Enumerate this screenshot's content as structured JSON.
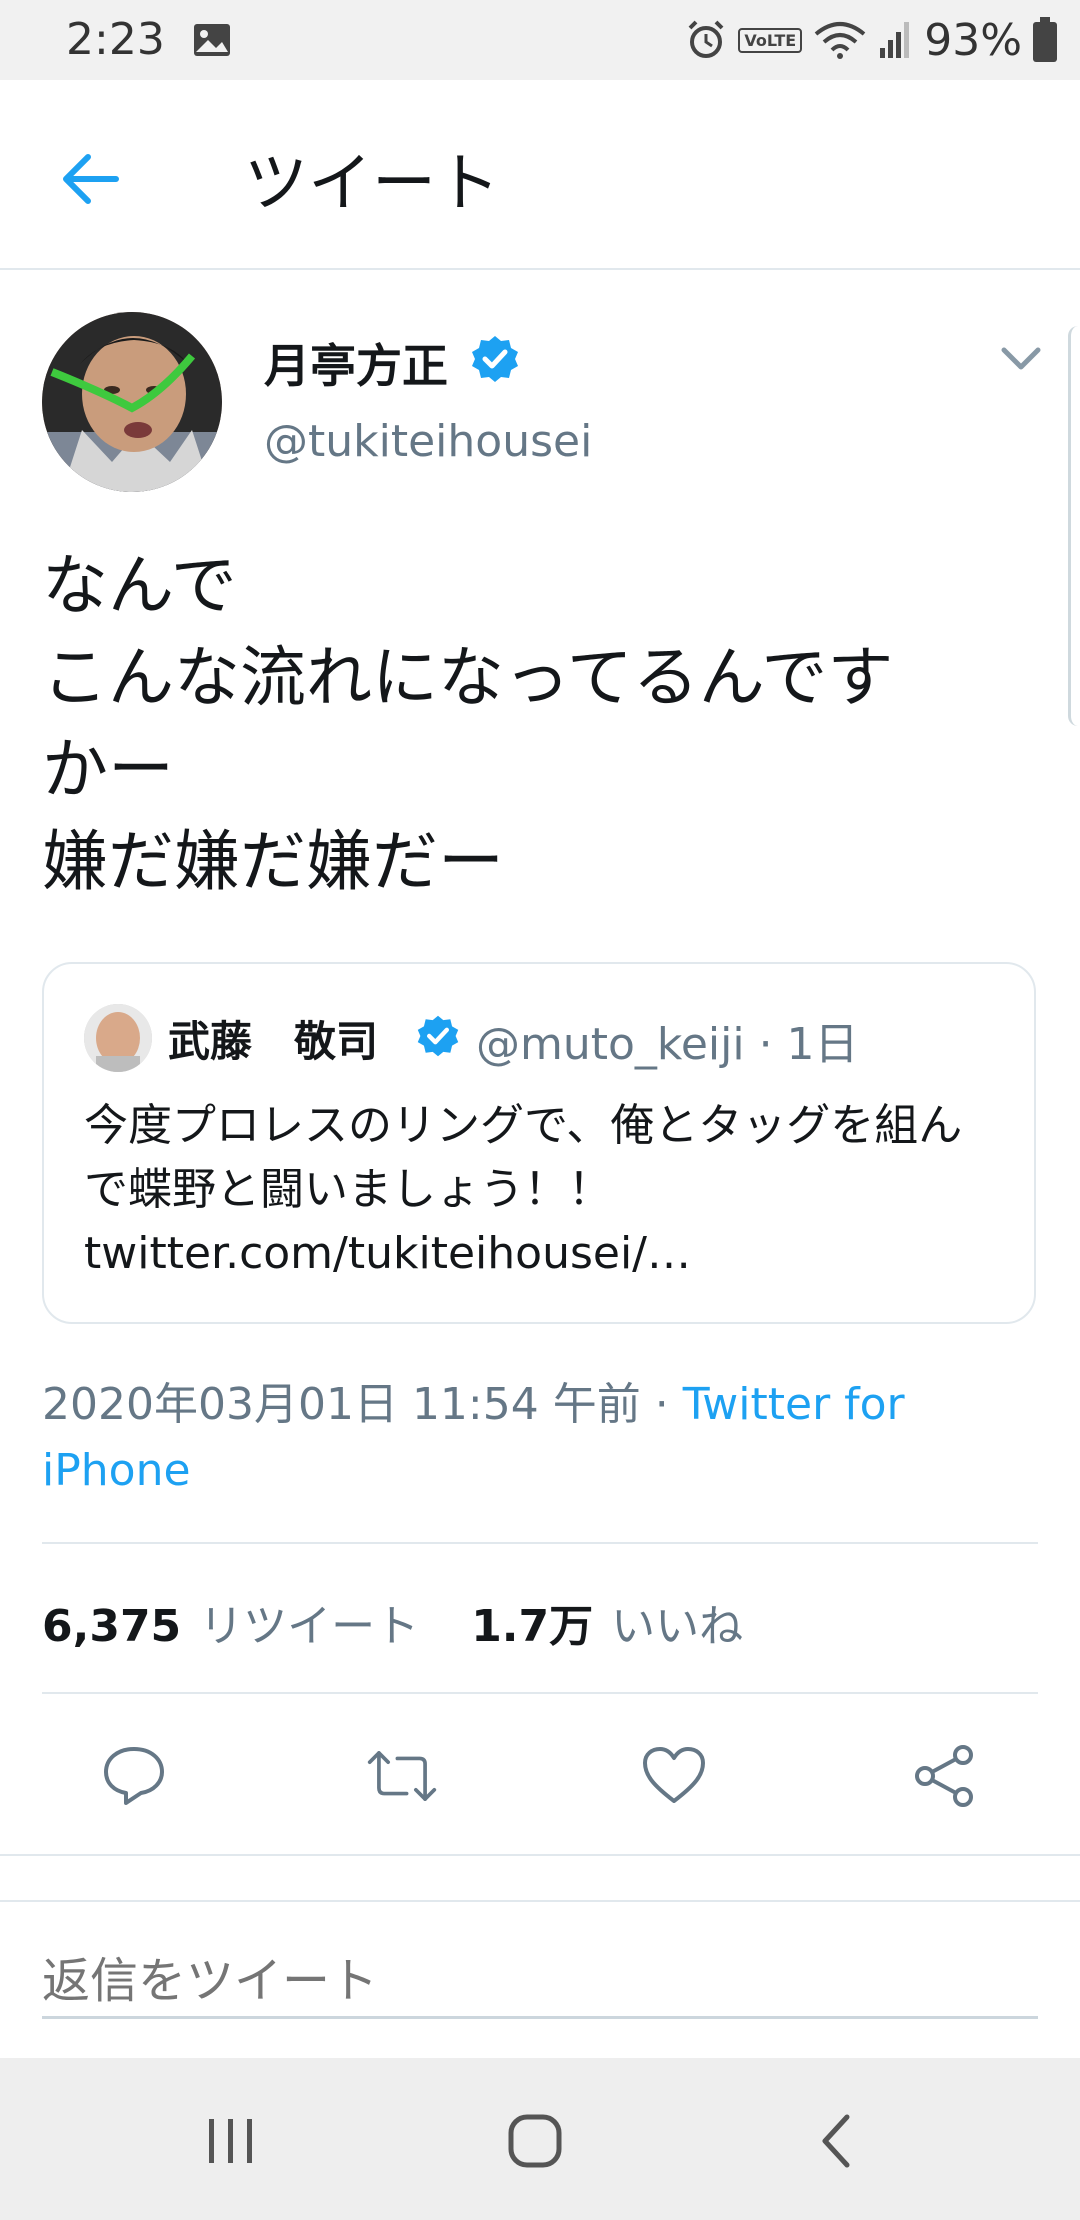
{
  "status_bar": {
    "time": "2:23",
    "volte_label": "VoLTE",
    "battery_percent": "93%"
  },
  "header": {
    "title": "ツイート"
  },
  "tweet": {
    "display_name": "月亭方正",
    "handle": "@tukiteihousei",
    "text": "なんで\nこんな流れになってるんです\nかー\n嫌だ嫌だ嫌だー",
    "timestamp": "2020年03月01日 11:54 午前 · ",
    "source": "Twitter for iPhone",
    "retweet_count": "6,375",
    "retweet_label": "リツイート",
    "like_count": "1.7万",
    "like_label": "いいね"
  },
  "quoted_tweet": {
    "display_name": "武藤　敬司",
    "handle_time": "@muto_keiji · 1日",
    "text": "今度プロレスのリングで、俺とタッグを組んで蝶野と闘いましょう！！ twitter.com/tukiteihousei/…"
  },
  "reply": {
    "placeholder": "返信をツイート"
  },
  "colors": {
    "accent": "#1da1f2",
    "secondary_text": "#657786",
    "divider": "#e1e8ed"
  }
}
